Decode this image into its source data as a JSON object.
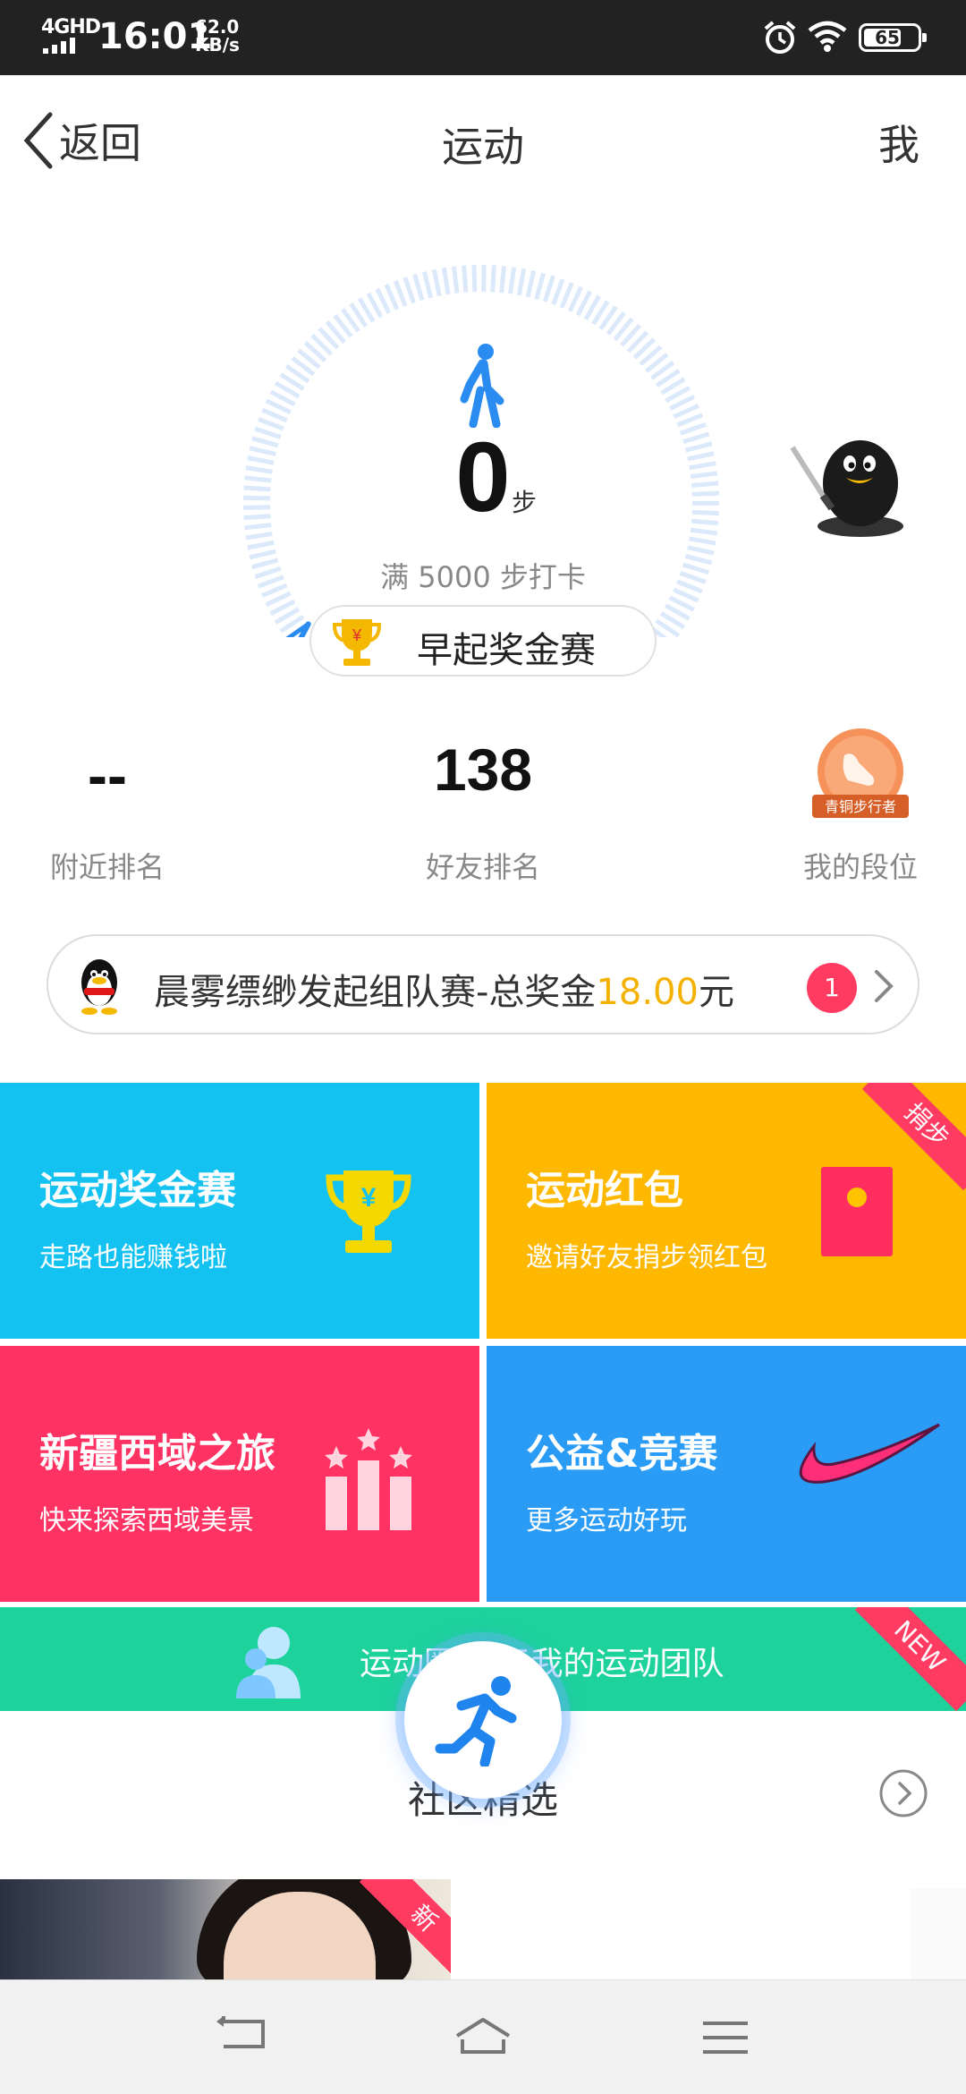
{
  "status_bar": {
    "network": "4GHD",
    "time": "16:01",
    "speed_value": "62.0",
    "speed_unit": "KB/s",
    "battery": "65"
  },
  "nav": {
    "back_label": "返回",
    "title": "运动",
    "me_label": "我"
  },
  "steps": {
    "count": "0",
    "unit": "步",
    "goal": "满 5000 步打卡",
    "contest_label": "早起奖金赛",
    "gauge_progress": 0
  },
  "stats": {
    "nearby_value": "--",
    "nearby_label": "附近排名",
    "friends_value": "138",
    "friends_label": "好友排名",
    "level_label": "我的段位",
    "level_badge_text": "青铜步行者"
  },
  "team_banner": {
    "text": "晨雾缥缈发起组队赛-总奖金",
    "amount": "18.00",
    "currency": "元",
    "badge": "1"
  },
  "tiles": [
    {
      "title": "运动奖金赛",
      "subtitle": "走路也能赚钱啦",
      "color": "#14c2f2"
    },
    {
      "title": "运动红包",
      "subtitle": "邀请好友捐步领红包",
      "color": "#ffb800",
      "corner": "捐步"
    },
    {
      "title": "新疆西域之旅",
      "subtitle": "快来探索西域美景",
      "color": "#ff3363"
    },
    {
      "title": "公益&竞赛",
      "subtitle": "更多运动好玩",
      "color": "#2a9cf5"
    }
  ],
  "circle_bar": {
    "text": "运动圈 属于我的运动团队",
    "corner": "NEW",
    "color": "#1ed39b"
  },
  "community": {
    "title": "社区精选",
    "thumb_corner": "新"
  },
  "colors": {
    "accent_blue": "#2a8cf0",
    "gold": "#f5b100",
    "badge_red": "#ff3b62"
  },
  "icons": [
    "back-chevron-icon",
    "walking-person-icon",
    "trophy-icon",
    "penguin-mascot-icon",
    "rank-badge-icon",
    "qq-penguin-icon",
    "chevron-right-icon",
    "red-packet-icon",
    "podium-stars-icon",
    "swoosh-icon",
    "people-icon",
    "running-person-icon",
    "circle-arrow-icon",
    "nav-back-icon",
    "nav-home-icon",
    "nav-menu-icon"
  ]
}
